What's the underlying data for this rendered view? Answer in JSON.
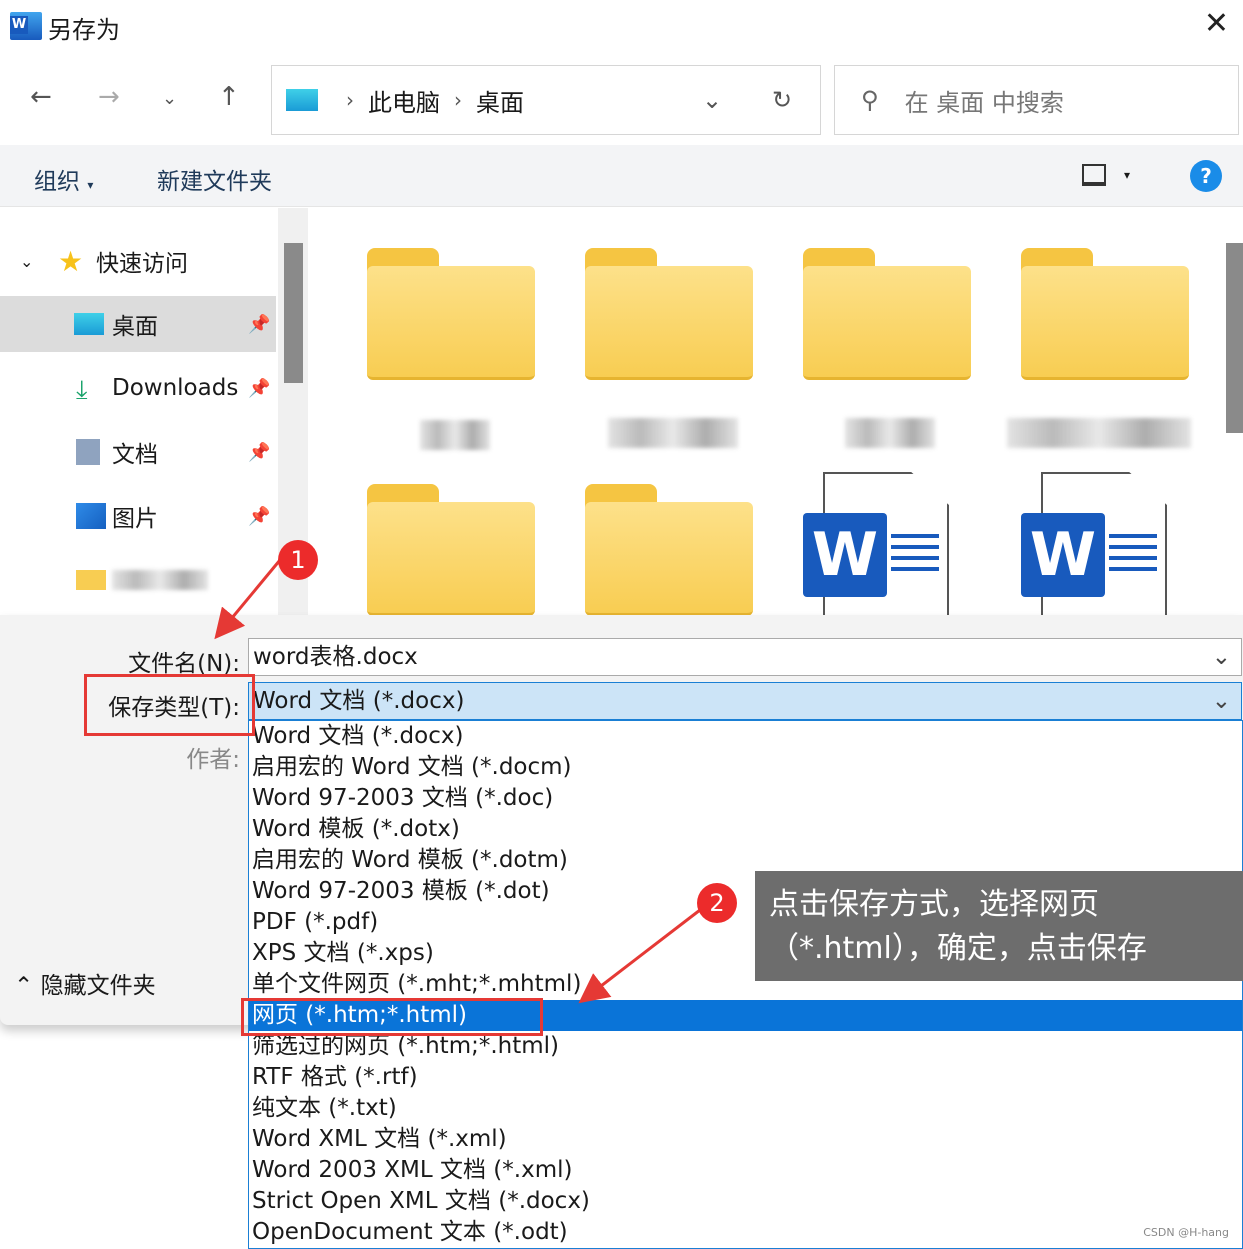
{
  "window": {
    "title": "另存为",
    "app_icon": "word-icon"
  },
  "address": {
    "crumbs": [
      "此电脑",
      "桌面"
    ]
  },
  "search": {
    "placeholder": "在 桌面 中搜索"
  },
  "toolbar": {
    "organize": "组织",
    "new_folder": "新建文件夹"
  },
  "sidebar": {
    "section": "快速访问",
    "items": [
      {
        "label": "桌面",
        "icon": "desktop-icon",
        "selected": true
      },
      {
        "label": "Downloads",
        "icon": "download-icon"
      },
      {
        "label": "文档",
        "icon": "documents-icon"
      },
      {
        "label": "图片",
        "icon": "pictures-icon"
      }
    ]
  },
  "form": {
    "filename_label": "文件名(N):",
    "filename_value": "word表格.docx",
    "type_label": "保存类型(T):",
    "type_value": "Word 文档 (*.docx)",
    "author_label": "作者:"
  },
  "hide_folders": "隐藏文件夹",
  "type_options": [
    "Word 文档 (*.docx)",
    "启用宏的 Word 文档 (*.docm)",
    "Word 97-2003 文档 (*.doc)",
    "Word 模板 (*.dotx)",
    "启用宏的 Word 模板 (*.dotm)",
    "Word 97-2003 模板 (*.dot)",
    "PDF (*.pdf)",
    "XPS 文档 (*.xps)",
    "单个文件网页 (*.mht;*.mhtml)",
    "网页 (*.htm;*.html)",
    "筛选过的网页 (*.htm;*.html)",
    "RTF 格式 (*.rtf)",
    "纯文本 (*.txt)",
    "Word XML 文档 (*.xml)",
    "Word 2003 XML 文档 (*.xml)",
    "Strict Open XML 文档 (*.docx)",
    "OpenDocument 文本 (*.odt)"
  ],
  "selected_option": "网页 (*.htm;*.html)",
  "annotations": {
    "step1": "1",
    "step2": "2",
    "callout": "点击保存方式，选择网页（*.html），确定，点击保存"
  },
  "watermark": "CSDN @H-hang",
  "colors": {
    "accent": "#0a74d8",
    "annotation": "#e53935"
  }
}
